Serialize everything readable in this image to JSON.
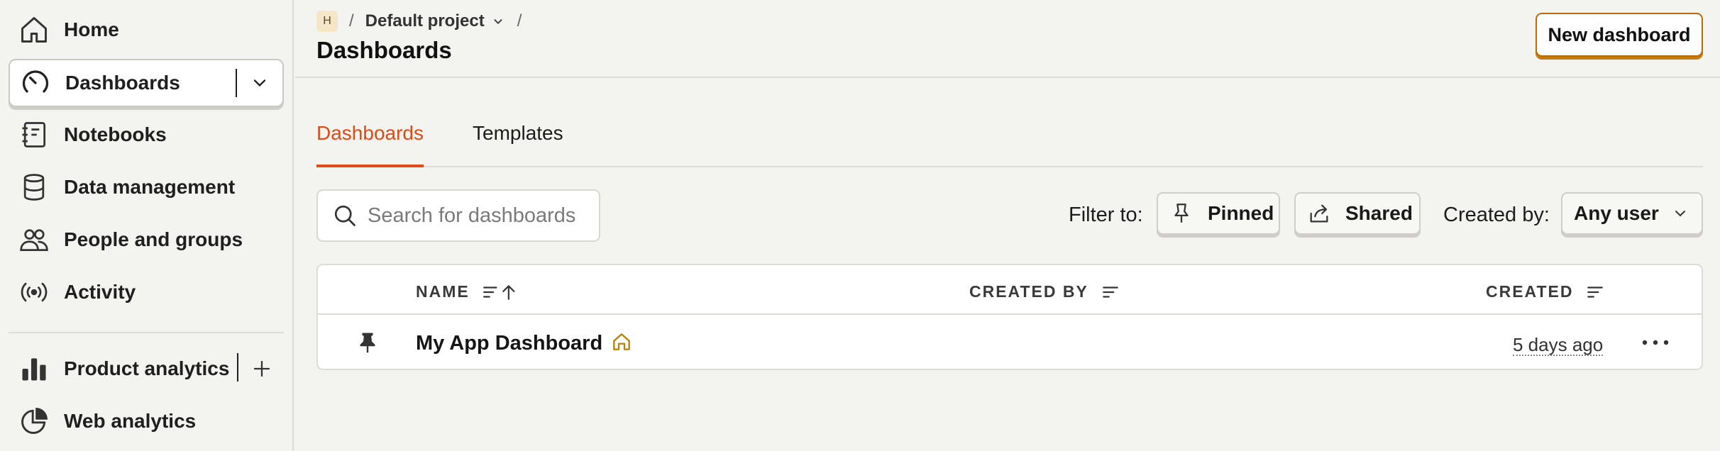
{
  "sidebar": {
    "items": [
      {
        "label": "Home",
        "icon": "home-icon"
      },
      {
        "label": "Dashboards",
        "icon": "dashboard-gauge-icon",
        "active": true
      },
      {
        "label": "Notebooks",
        "icon": "notebook-icon"
      },
      {
        "label": "Data management",
        "icon": "database-icon"
      },
      {
        "label": "People and groups",
        "icon": "people-icon"
      },
      {
        "label": "Activity",
        "icon": "broadcast-icon"
      },
      {
        "label": "Product analytics",
        "icon": "bar-chart-icon"
      },
      {
        "label": "Web analytics",
        "icon": "pie-chart-icon"
      }
    ]
  },
  "header": {
    "project_badge": "H",
    "project_name": "Default project",
    "crumb_separator": "/",
    "title": "Dashboards",
    "new_button": "New dashboard"
  },
  "tabs": [
    {
      "label": "Dashboards",
      "active": true
    },
    {
      "label": "Templates",
      "active": false
    }
  ],
  "filters": {
    "search_placeholder": "Search for dashboards",
    "search_value": "",
    "filter_label": "Filter to:",
    "pinned_label": "Pinned",
    "shared_label": "Shared",
    "created_by_label": "Created by:",
    "created_by_value": "Any user"
  },
  "table": {
    "columns": [
      "NAME",
      "CREATED BY",
      "CREATED"
    ],
    "rows": [
      {
        "name": "My App Dashboard",
        "pinned": true,
        "is_home": true,
        "created_by": "",
        "created": "5 days ago"
      }
    ]
  },
  "colors": {
    "accent": "#e04a14",
    "primary_button_border": "#b66b08",
    "background": "#f3f3ef"
  }
}
